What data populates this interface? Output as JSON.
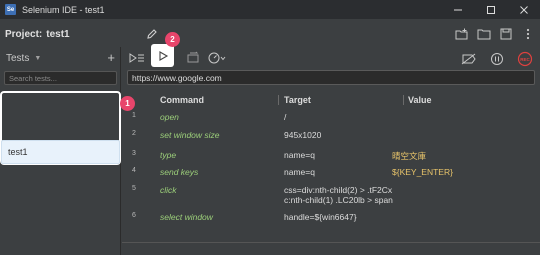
{
  "window": {
    "title": "Selenium IDE - test1",
    "app_icon": "Se"
  },
  "project": {
    "label": "Project:",
    "name": "test1"
  },
  "tests": {
    "header": "Tests",
    "add_symbol": "+",
    "search_placeholder": "Search tests...",
    "items": [
      {
        "name": "test1"
      }
    ]
  },
  "url": {
    "value": "https://www.google.com"
  },
  "table": {
    "headers": [
      "Command",
      "Target",
      "Value"
    ],
    "rows": [
      {
        "num": "1",
        "command": "open",
        "target": "/",
        "value": ""
      },
      {
        "num": "2",
        "command": "set window size",
        "target": "945x1020",
        "value": ""
      },
      {
        "num": "3",
        "command": "type",
        "target": "name=q",
        "value": "晴空文庫"
      },
      {
        "num": "4",
        "command": "send keys",
        "target": "name=q",
        "value": "${KEY_ENTER}"
      },
      {
        "num": "5",
        "command": "click",
        "target": "css=div:nth-child(2) > .tF2Cx c:nth-child(1) .LC20lb > span",
        "value": ""
      },
      {
        "num": "6",
        "command": "select window",
        "target": "handle=${win6647}",
        "value": ""
      }
    ]
  },
  "annotations": {
    "badge_1": "1",
    "badge_2": "2"
  },
  "icons": {
    "edit": "pencil-icon",
    "new_project": "new-project-icon",
    "open_project": "folder-icon",
    "save_project": "save-icon",
    "more": "more-vert-icon",
    "run_all": "run-all-tests-icon",
    "run_current": "play-icon",
    "step": "step-over-icon",
    "speed": "speed-icon",
    "disable_breakpoints": "disable-breakpoints-icon",
    "pause_on_exceptions": "pause-exceptions-icon",
    "record": "record-icon"
  },
  "colors": {
    "badge": "#e8456b",
    "command_text": "#9ccf7a",
    "value_text": "#e8c46a",
    "selected_test_bg": "#e8f2fb"
  }
}
